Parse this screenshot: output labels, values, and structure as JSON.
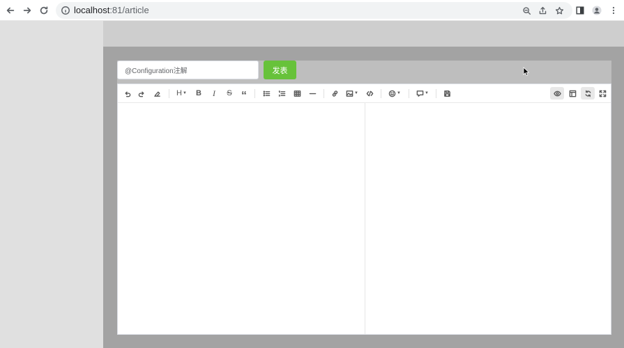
{
  "browser": {
    "url_host": "localhost",
    "url_path": ":81/article"
  },
  "article": {
    "title_value": "@Configuration注解",
    "publish_label": "发表"
  },
  "editor": {
    "toolbar_left": [
      "undo-icon",
      "redo-icon",
      "clear-format-icon",
      "heading-icon",
      "bold-icon",
      "italic-icon",
      "strikethrough-icon",
      "quote-icon",
      "unordered-list-icon",
      "ordered-list-icon",
      "table-icon",
      "horizontal-rule-icon",
      "link-icon",
      "image-icon",
      "code-icon",
      "emoji-icon",
      "comment-icon",
      "save-icon"
    ],
    "toolbar_right": [
      "preview-icon",
      "html-preview-icon",
      "sync-scroll-icon",
      "fullscreen-icon"
    ],
    "heading_label": "H",
    "bold_label": "B",
    "italic_label": "I",
    "strike_label": "S",
    "quote_label": "“",
    "markdown_content": "",
    "preview_content": ""
  },
  "colors": {
    "publish_button": "#67c23a",
    "backdrop": "#a3a3a3"
  }
}
